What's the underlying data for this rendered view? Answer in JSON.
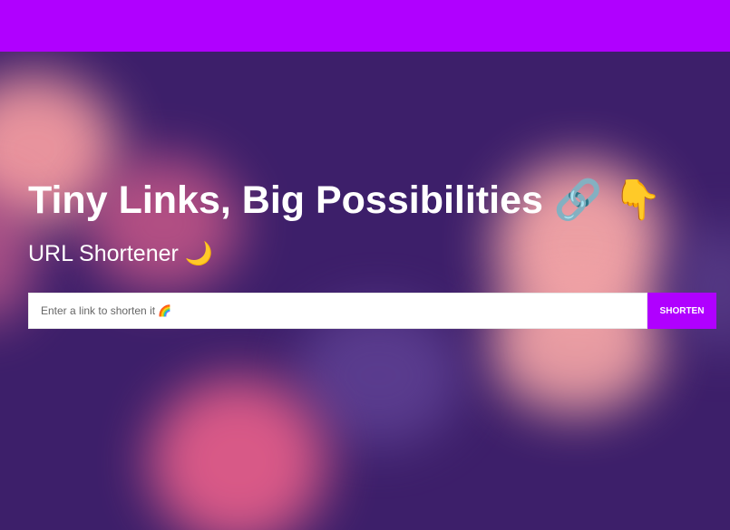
{
  "hero": {
    "title": "Tiny Links, Big Possibilities 🔗 👇",
    "subtitle": "URL Shortener 🌙"
  },
  "form": {
    "placeholder": "Enter a link to shorten it 🌈",
    "button_label": "SHORTEN"
  },
  "colors": {
    "topbar": "#b000ff",
    "background": "#3d1f6a",
    "button": "#b000ff",
    "text": "#ffffff"
  }
}
